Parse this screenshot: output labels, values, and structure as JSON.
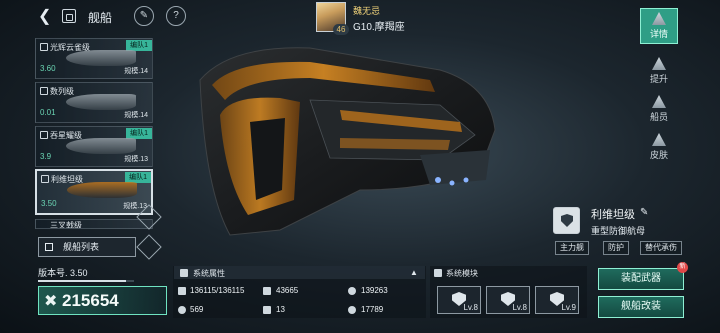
{
  "header": {
    "back_icon": "back-arrow-icon",
    "home_icon": "home-icon",
    "title": "舰船",
    "tool_icons": [
      "wrench-icon",
      "question-icon"
    ],
    "question_glyph": "?"
  },
  "commander": {
    "avatar_icon": "commander-portrait",
    "level": "46",
    "name": "魏无忌",
    "position": "G10.摩羯座"
  },
  "fleet": {
    "ships": [
      {
        "name": "光辉云雀级",
        "fleet": "编队1",
        "version": "3.60",
        "scale": "规模.14"
      },
      {
        "name": "数列级",
        "fleet": "",
        "version": "0.01",
        "scale": "规模.14"
      },
      {
        "name": "吞星耀级",
        "fleet": "编队1",
        "version": "3.9",
        "scale": "规模.13"
      },
      {
        "name": "利维坦级",
        "fleet": "编队1",
        "version": "3.50",
        "scale": "规模.13"
      },
      {
        "name": "三叉戟级",
        "fleet": "",
        "version": "",
        "scale": ""
      }
    ],
    "list_button": "舰船列表"
  },
  "right_menu": {
    "tabs": [
      {
        "label": "详情",
        "icon": "detail-icon",
        "active": true
      },
      {
        "label": "提升",
        "icon": "upgrade-icon",
        "active": false
      },
      {
        "label": "船员",
        "icon": "crew-icon",
        "active": false
      },
      {
        "label": "皮肤",
        "icon": "skin-icon",
        "active": false
      }
    ]
  },
  "ship": {
    "name": "利维坦级",
    "edit_icon": "pencil-icon",
    "class": "重型防御航母",
    "tags": [
      "主力舰",
      "防护",
      "替代承伤"
    ]
  },
  "bottom": {
    "version_label": "版本号. 3.50",
    "version_progress": 0.92,
    "power_icon": "crossed-swords-icon",
    "power_value": "215654",
    "attributes_title": "系统属性",
    "attributes": [
      {
        "icon": "hull-icon",
        "value": "136115/136115"
      },
      {
        "icon": "armor-icon",
        "value": "43665"
      },
      {
        "icon": "shield-icon",
        "value": "139263"
      },
      {
        "icon": "speed-icon",
        "value": "569"
      },
      {
        "icon": "grid-icon",
        "value": "13"
      },
      {
        "icon": "target-icon",
        "value": "17789"
      }
    ],
    "modules_title": "系统模块",
    "modules": [
      {
        "icon": "module-shield-icon",
        "level": "Lv.8"
      },
      {
        "icon": "module-defense-icon",
        "level": "Lv.8"
      },
      {
        "icon": "module-cross-icon",
        "level": "Lv.9"
      }
    ],
    "equip_button": "装配武器",
    "refit_button": "舰船改装",
    "badge": "新"
  },
  "colors": {
    "accent": "#2f9e86",
    "accent_border": "#8ff0d4",
    "fleet_tag": "#37b59a",
    "gold_text": "#f3d57b",
    "ship_orange": "#c8791a"
  }
}
